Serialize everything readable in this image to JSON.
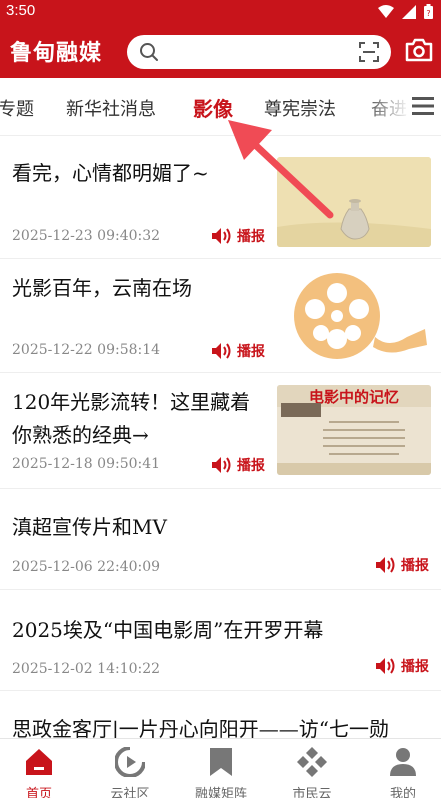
{
  "status_bar": {
    "time": "3:50"
  },
  "header": {
    "app_title": "鲁甸融媒"
  },
  "tabs": [
    {
      "label": "专题"
    },
    {
      "label": "新华社消息"
    },
    {
      "label": "影像"
    },
    {
      "label": "尊宪崇法"
    },
    {
      "label": "奋进"
    }
  ],
  "active_tab": "影像",
  "articles": [
    {
      "title": "看完，心情都明媚了~",
      "date": "2025-12-23 09:40:32",
      "play_label": "播报"
    },
    {
      "title": "光影百年，云南在场",
      "date": "2025-12-22 09:58:14",
      "play_label": "播报"
    },
    {
      "title_line1": "120年光影流转！这里藏着",
      "title_line2": "你熟悉的经典→",
      "date": "2025-12-18 09:50:41",
      "play_label": "播报",
      "thumb_text": "电影中的记忆"
    },
    {
      "title": "滇超宣传片和MV",
      "date": "2025-12-06 22:40:09",
      "play_label": "播报"
    },
    {
      "title": "2025埃及“中国电影周”在开罗开幕",
      "date": "2025-12-02 14:10:22",
      "play_label": "播报"
    },
    {
      "title": "思政金客厅|一片丹心向阳开——访“七一勋"
    }
  ],
  "bottom_nav": [
    {
      "label": "首页",
      "icon": "home-icon"
    },
    {
      "label": "云社区",
      "icon": "community-icon"
    },
    {
      "label": "融媒矩阵",
      "icon": "bookmark-icon"
    },
    {
      "label": "市民云",
      "icon": "diamond-grid-icon"
    },
    {
      "label": "我的",
      "icon": "user-icon"
    }
  ],
  "colors": {
    "brand_red": "#c8141b",
    "arrow": "#f04b55"
  }
}
